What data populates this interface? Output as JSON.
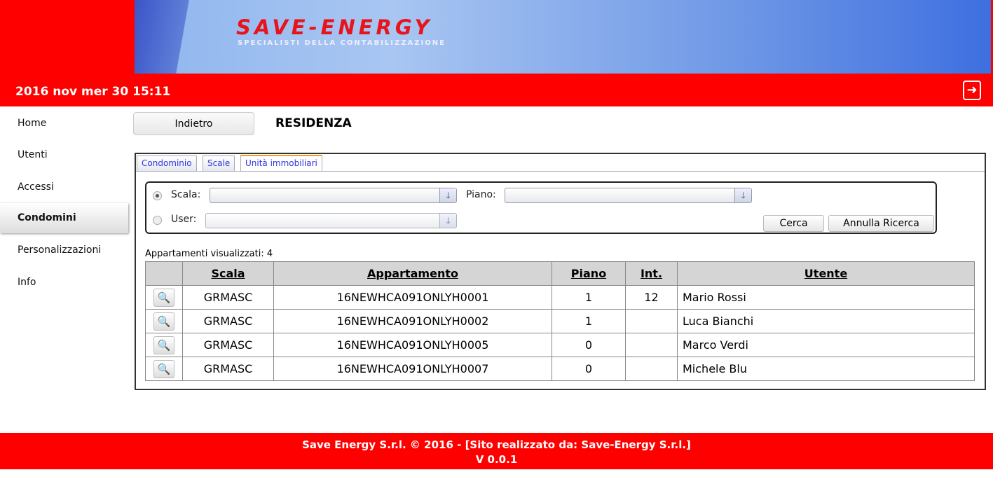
{
  "header": {
    "logo": "SAVE-ENERGY",
    "slogan": "SPECIALISTI DELLA CONTABILIZZAZIONE",
    "datetime": "2016 nov mer 30 15:11"
  },
  "sidebar": {
    "items": [
      {
        "label": "Home"
      },
      {
        "label": "Utenti"
      },
      {
        "label": "Accessi"
      },
      {
        "label": "Condomini",
        "active": true
      },
      {
        "label": "Personalizzazioni"
      },
      {
        "label": "Info"
      }
    ]
  },
  "main": {
    "back_label": "Indietro",
    "title": "RESIDENZA",
    "tabs": [
      {
        "label": "Condominio"
      },
      {
        "label": "Scale"
      },
      {
        "label": "Unità immobiliari",
        "active": true
      }
    ],
    "filter": {
      "scala_label": "Scala:",
      "scala_value": "",
      "piano_label": "Piano:",
      "piano_value": "",
      "user_label": "User:",
      "user_value": "",
      "search_label": "Cerca",
      "cancel_label": "Annulla Ricerca"
    },
    "count_label": "Appartamenti visualizzati: 4",
    "table": {
      "headers": [
        "",
        "Scala",
        "Appartamento",
        "Piano",
        "Int.",
        "Utente"
      ],
      "rows": [
        [
          "GRMASC",
          "16NEWHCA091ONLYH0001",
          "1",
          "12",
          "Mario Rossi"
        ],
        [
          "GRMASC",
          "16NEWHCA091ONLYH0002",
          "1",
          "",
          "Luca Bianchi"
        ],
        [
          "GRMASC",
          "16NEWHCA091ONLYH0005",
          "0",
          "",
          "Marco Verdi"
        ],
        [
          "GRMASC",
          "16NEWHCA091ONLYH0007",
          "0",
          "",
          "Michele Blu"
        ]
      ]
    }
  },
  "footer": {
    "line1": "Save Energy S.r.l. © 2016 - [Sito realizzato da: Save-Energy S.r.l.]",
    "version": "V 0.0.1"
  }
}
